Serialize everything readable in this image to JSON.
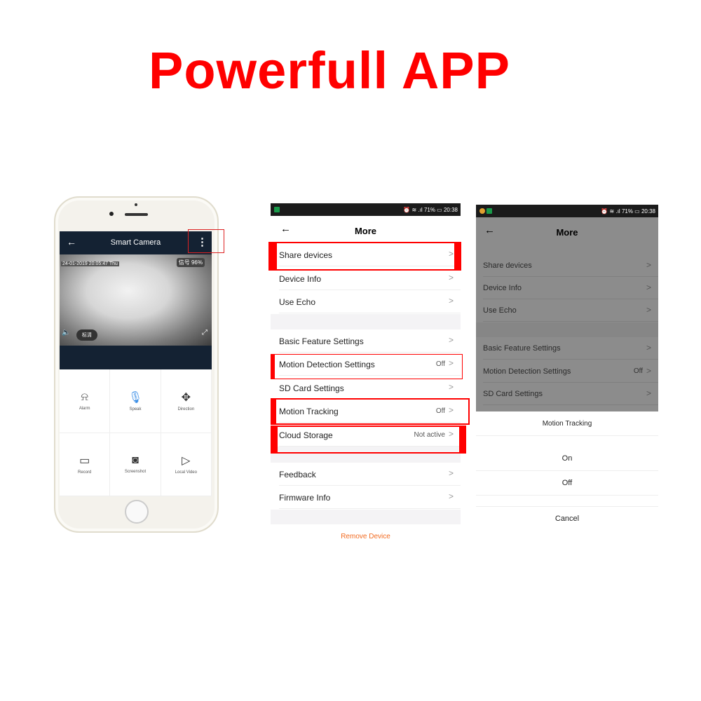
{
  "banner": {
    "title": "Powerfull APP",
    "title_color": "#ff0000"
  },
  "phone_screen": {
    "header": {
      "title": "Smart Camera",
      "back_icon": "arrow-left",
      "menu_icon": "vertical-ellipsis"
    },
    "video": {
      "timestamp": "24-01-2019  20:05:47  Thu",
      "signal": "信号 96%",
      "quality": "标清",
      "mute_icon": "speaker-mute",
      "fullscreen_icon": "expand"
    },
    "controls": [
      {
        "label": "Alarm",
        "icon": "siren"
      },
      {
        "label": "Speak",
        "icon": "microphone"
      },
      {
        "label": "Direction",
        "icon": "move-arrows"
      },
      {
        "label": "Record",
        "icon": "video-camera"
      },
      {
        "label": "Screenshot",
        "icon": "camera"
      },
      {
        "label": "Local Video",
        "icon": "play-circle"
      }
    ]
  },
  "more_screen": {
    "status": {
      "battery": "71%",
      "time": "20:38"
    },
    "header": {
      "title": "More"
    },
    "rows": [
      {
        "label": "Share devices",
        "value": ""
      },
      {
        "label": "Device Info",
        "value": ""
      },
      {
        "label": "Use Echo",
        "value": ""
      },
      {
        "label": "Basic Feature Settings",
        "value": ""
      },
      {
        "label": "Motion Detection Settings",
        "value": "Off"
      },
      {
        "label": "SD Card Settings",
        "value": ""
      },
      {
        "label": "Motion Tracking",
        "value": "Off"
      },
      {
        "label": "Cloud Storage",
        "value": "Not active"
      },
      {
        "label": "Feedback",
        "value": ""
      },
      {
        "label": "Firmware Info",
        "value": ""
      }
    ],
    "remove_label": "Remove Device",
    "remove_color": "#f26b21",
    "highlight_color": "#ff0000"
  },
  "sheet_screen": {
    "status": {
      "battery": "71%",
      "time": "20:38"
    },
    "header": {
      "title": "More"
    },
    "rows": [
      {
        "label": "Share devices",
        "value": ""
      },
      {
        "label": "Device Info",
        "value": ""
      },
      {
        "label": "Use Echo",
        "value": ""
      },
      {
        "label": "Basic Feature Settings",
        "value": ""
      },
      {
        "label": "Motion Detection Settings",
        "value": "Off"
      },
      {
        "label": "SD Card Settings",
        "value": ""
      }
    ],
    "sheet": {
      "title": "Motion Tracking",
      "options": [
        "On",
        "Off"
      ],
      "cancel": "Cancel"
    }
  }
}
